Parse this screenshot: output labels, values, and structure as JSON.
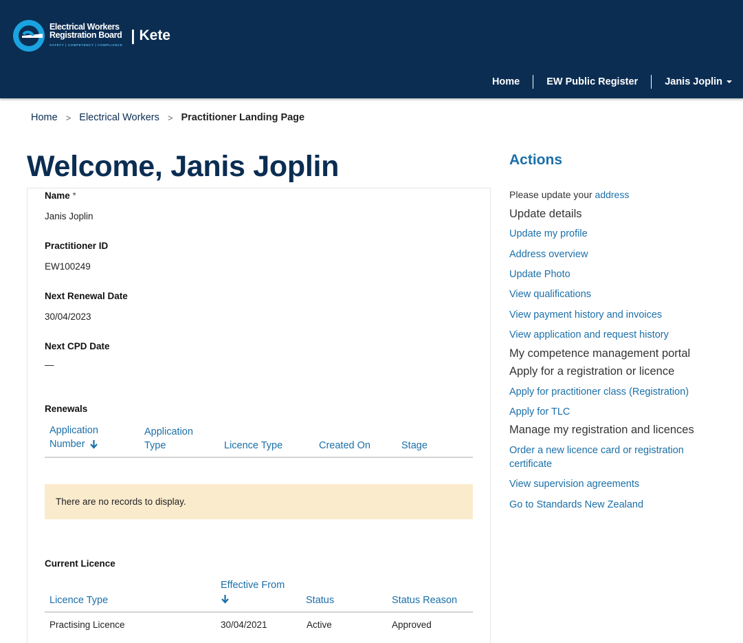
{
  "brand": {
    "line1": "Electrical Workers",
    "line2": "Registration Board",
    "tagline": "SAFETY | COMPETENCY | COMPLIANCE",
    "separator": "|",
    "app_name": "Kete"
  },
  "topnav": {
    "home": "Home",
    "register": "EW Public Register",
    "user": "Janis Joplin"
  },
  "breadcrumb": {
    "home": "Home",
    "section": "Electrical Workers",
    "current": "Practitioner Landing Page",
    "sep": ">"
  },
  "welcome": "Welcome, Janis Joplin",
  "profile": {
    "name_label": "Name",
    "name_required": "*",
    "name_value": "Janis Joplin",
    "id_label": "Practitioner ID",
    "id_value": "EW100249",
    "renewal_label": "Next Renewal Date",
    "renewal_value": "30/04/2023",
    "cpd_label": "Next CPD Date",
    "cpd_value": "—"
  },
  "renewals": {
    "title": "Renewals",
    "columns": [
      "Application Number",
      "Application Type",
      "Licence Type",
      "Created On",
      "Stage"
    ],
    "col0_line1": "Application",
    "col0_line2": "Number",
    "col1_line1": "Application",
    "col1_line2": "Type",
    "empty_message": "There are no records to display."
  },
  "current_licence": {
    "title": "Current Licence",
    "col_licence_type": "Licence Type",
    "col_effective_from": "Effective From",
    "col_status": "Status",
    "col_status_reason": "Status Reason",
    "rows": [
      {
        "licence_type": "Practising Licence",
        "effective_from": "30/04/2021",
        "status": "Active",
        "status_reason": "Approved"
      }
    ]
  },
  "actions": {
    "title": "Actions",
    "notice_prefix": "Please update your",
    "notice_link": "address",
    "update_details_heading": "Update details",
    "update_profile": "Update my profile",
    "address_overview": "Address overview",
    "update_photo": "Update Photo",
    "view_qualifications": "View qualifications",
    "view_payments": "View payment history and invoices",
    "view_applications": "View application and request history",
    "competence_heading": "My competence management portal",
    "apply_heading": "Apply for a registration or licence",
    "apply_practitioner": "Apply for practitioner class (Registration)",
    "apply_tlc": "Apply for TLC",
    "manage_heading": "Manage my registration and licences",
    "order_card_line1": "Order a new licence card or registration",
    "order_card_line2": "certificate",
    "view_supervision": "View supervision agreements",
    "standards_nz": "Go to Standards New Zealand"
  },
  "colors": {
    "header_bg": "#0b2d52",
    "link": "#1b6fa8",
    "notice_bg": "#faebcd",
    "logo_blue": "#1aa3e0"
  },
  "icons": {
    "logo": "ewrb-logo-icon",
    "sort": "sort-down-arrow-icon",
    "dropdown": "caret-down-icon"
  }
}
